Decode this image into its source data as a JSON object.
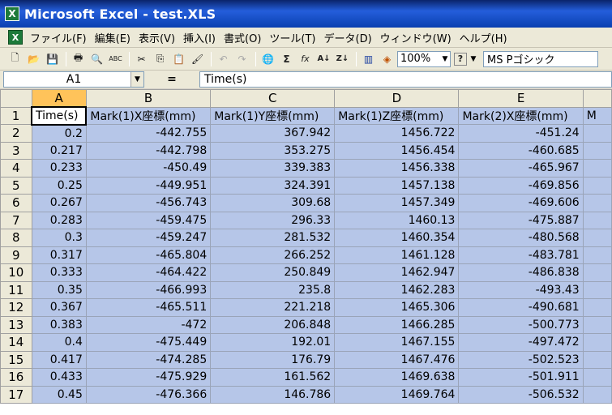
{
  "window": {
    "title": "Microsoft Excel - test.XLS",
    "app_icon": "excel-icon"
  },
  "menu": {
    "items": [
      "ファイル(F)",
      "編集(E)",
      "表示(V)",
      "挿入(I)",
      "書式(O)",
      "ツール(T)",
      "データ(D)",
      "ウィンドウ(W)",
      "ヘルプ(H)"
    ]
  },
  "toolbar": {
    "zoom": "100%",
    "font": "MS Pゴシック",
    "icons": [
      "new-icon",
      "open-icon",
      "save-icon",
      "print-icon",
      "print-preview-icon",
      "spellcheck-icon",
      "cut-icon",
      "copy-icon",
      "paste-icon",
      "format-painter-icon",
      "undo-icon",
      "redo-icon",
      "hyperlink-icon",
      "autosum-icon",
      "function-icon",
      "sort-ascending-icon",
      "sort-descending-icon",
      "chart-wizard-icon",
      "drawing-icon",
      "help-icon"
    ],
    "glyphs": {
      "new": "🗋",
      "open": "📂",
      "save": "💾",
      "print": "🖶",
      "preview": "🔍",
      "spell": "ABC",
      "cut": "✂",
      "copy": "⎘",
      "paste": "📋",
      "painter": "🖌",
      "undo": "↶",
      "redo": "↷",
      "hyperlink": "🌐",
      "sum": "Σ",
      "fx": "fx",
      "sortasc": "A↓",
      "sortdesc": "Z↓",
      "chart": "▥",
      "drawing": "◈",
      "help": "?"
    }
  },
  "formula": {
    "name_box": "A1",
    "equals": "=",
    "content": "Time(s)"
  },
  "sheet": {
    "columns": [
      "A",
      "B",
      "C",
      "D",
      "E",
      ""
    ],
    "rows": [
      [
        "Time(s)",
        "Mark(1)X座標(mm)",
        "Mark(1)Y座標(mm)",
        "Mark(1)Z座標(mm)",
        "Mark(2)X座標(mm)",
        "M"
      ],
      [
        "0.2",
        "-442.755",
        "367.942",
        "1456.722",
        "-451.24",
        ""
      ],
      [
        "0.217",
        "-442.798",
        "353.275",
        "1456.454",
        "-460.685",
        ""
      ],
      [
        "0.233",
        "-450.49",
        "339.383",
        "1456.338",
        "-465.967",
        ""
      ],
      [
        "0.25",
        "-449.951",
        "324.391",
        "1457.138",
        "-469.856",
        ""
      ],
      [
        "0.267",
        "-456.743",
        "309.68",
        "1457.349",
        "-469.606",
        ""
      ],
      [
        "0.283",
        "-459.475",
        "296.33",
        "1460.13",
        "-475.887",
        ""
      ],
      [
        "0.3",
        "-459.247",
        "281.532",
        "1460.354",
        "-480.568",
        ""
      ],
      [
        "0.317",
        "-465.804",
        "266.252",
        "1461.128",
        "-483.781",
        ""
      ],
      [
        "0.333",
        "-464.422",
        "250.849",
        "1462.947",
        "-486.838",
        ""
      ],
      [
        "0.35",
        "-466.993",
        "235.8",
        "1462.283",
        "-493.43",
        ""
      ],
      [
        "0.367",
        "-465.511",
        "221.218",
        "1465.306",
        "-490.681",
        ""
      ],
      [
        "0.383",
        "-472",
        "206.848",
        "1466.285",
        "-500.773",
        ""
      ],
      [
        "0.4",
        "-475.449",
        "192.01",
        "1467.155",
        "-497.472",
        ""
      ],
      [
        "0.417",
        "-474.285",
        "176.79",
        "1467.476",
        "-502.523",
        ""
      ],
      [
        "0.433",
        "-475.929",
        "161.562",
        "1469.638",
        "-501.911",
        ""
      ],
      [
        "0.45",
        "-476.366",
        "146.786",
        "1469.764",
        "-506.532",
        ""
      ]
    ]
  }
}
